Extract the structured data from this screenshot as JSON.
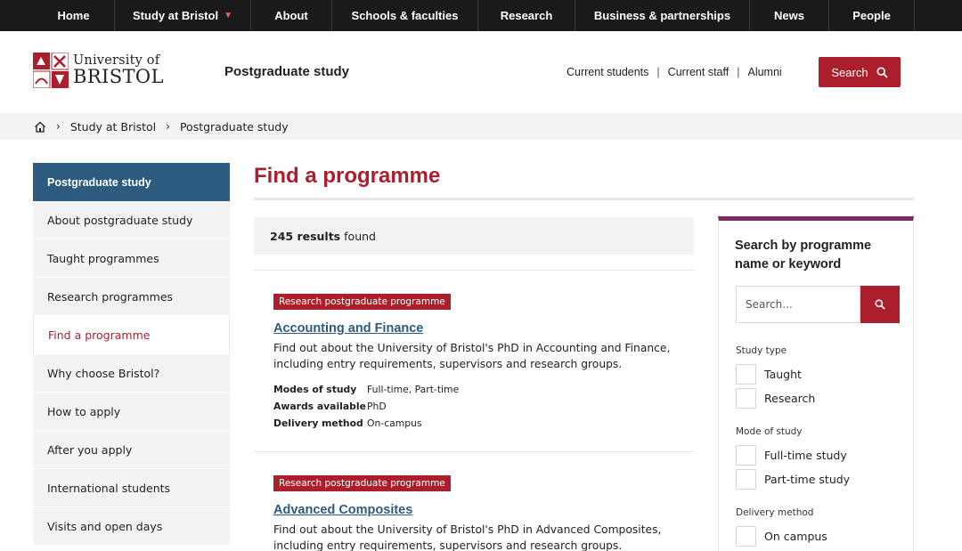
{
  "topnav": {
    "items": [
      {
        "label": "Home"
      },
      {
        "label": "Study at Bristol",
        "has_caret": true
      },
      {
        "label": "About"
      },
      {
        "label": "Schools & faculties"
      },
      {
        "label": "Research"
      },
      {
        "label": "Business & partnerships"
      },
      {
        "label": "News"
      },
      {
        "label": "People"
      }
    ]
  },
  "header": {
    "logo_line1": "University of",
    "logo_line2": "BRISTOL",
    "site_title": "Postgraduate study",
    "audience_links": [
      "Current students",
      "Current staff",
      "Alumni"
    ],
    "audience_separator": "|",
    "search_label": "Search"
  },
  "breadcrumb": {
    "items": [
      "Study at Bristol",
      "Postgraduate study"
    ]
  },
  "sidebar": {
    "heading": "Postgraduate study",
    "items": [
      {
        "label": "About postgraduate study"
      },
      {
        "label": "Taught programmes"
      },
      {
        "label": "Research programmes"
      },
      {
        "label": "Find a programme",
        "active": true
      },
      {
        "label": "Why choose Bristol?"
      },
      {
        "label": "How to apply"
      },
      {
        "label": "After you apply"
      },
      {
        "label": "International students"
      },
      {
        "label": "Visits and open days"
      }
    ]
  },
  "main": {
    "title": "Find a programme",
    "results_count": "245 results",
    "results_suffix": "found",
    "programmes": [
      {
        "badge": "Research postgraduate programme",
        "title": "Accounting and Finance",
        "description": "Find out about the University of Bristol's PhD in Accounting and Finance, including entry requirements, supervisors and research groups.",
        "meta": [
          {
            "key": "Modes of study",
            "value": "Full-time, Part-time"
          },
          {
            "key": "Awards available",
            "value": "PhD"
          },
          {
            "key": "Delivery method",
            "value": "On-campus"
          }
        ]
      },
      {
        "badge": "Research postgraduate programme",
        "title": "Advanced Composites",
        "description": "Find out about the University of Bristol's PhD in Advanced Composites, including entry requirements, supervisors and research groups.",
        "meta": []
      }
    ]
  },
  "filter": {
    "heading": "Search by programme name or keyword",
    "search_placeholder": "Search...",
    "groups": [
      {
        "label": "Study type",
        "options": [
          "Taught",
          "Research"
        ]
      },
      {
        "label": "Mode of study",
        "options": [
          "Full-time study",
          "Part-time study"
        ]
      },
      {
        "label": "Delivery method",
        "options": [
          "On campus"
        ]
      }
    ]
  },
  "colors": {
    "brand_red": "#ab1f2d",
    "nav_dark": "#1a1a1a",
    "sidebar_blue": "#2d5b80",
    "link_blue": "#2d5b80",
    "filter_accent": "#7a2a5e"
  },
  "icons": {
    "home": "home-icon",
    "chevron": "chevron-right-icon",
    "search": "search-icon",
    "caret": "chevron-down-icon"
  }
}
